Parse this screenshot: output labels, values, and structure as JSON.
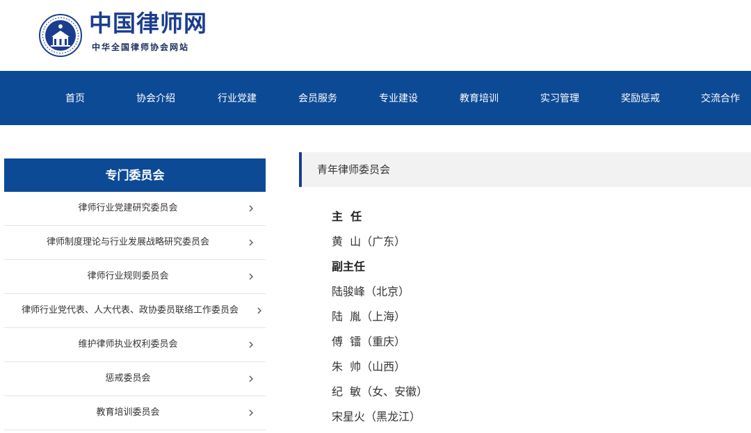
{
  "site": {
    "title": "中国律师网",
    "subtitle": "中华全国律师协会网站"
  },
  "nav": {
    "items": [
      {
        "label": "首页"
      },
      {
        "label": "协会介绍"
      },
      {
        "label": "行业党建"
      },
      {
        "label": "会员服务"
      },
      {
        "label": "专业建设"
      },
      {
        "label": "教育培训"
      },
      {
        "label": "实习管理"
      },
      {
        "label": "奖励惩戒"
      },
      {
        "label": "交流合作"
      }
    ]
  },
  "sidebar": {
    "title": "专门委员会",
    "items": [
      {
        "label": "律师行业党建研究委员会"
      },
      {
        "label": "律师制度理论与行业发展战略研究委员会"
      },
      {
        "label": "律师行业规则委员会"
      },
      {
        "label": "律师行业党代表、人大代表、政协委员联络工作委员会"
      },
      {
        "label": "维护律师执业权利委员会"
      },
      {
        "label": "惩戒委员会"
      },
      {
        "label": "教育培训委员会"
      }
    ]
  },
  "content": {
    "title": "青年律师委员会",
    "lines": [
      {
        "text": "主  任",
        "heading": true
      },
      {
        "text": "黄  山（广东）",
        "heading": false
      },
      {
        "text": "副主任",
        "heading": true
      },
      {
        "text": "陆骏峰（北京）",
        "heading": false
      },
      {
        "text": "陆  胤（上海）",
        "heading": false
      },
      {
        "text": "傅  镭（重庆）",
        "heading": false
      },
      {
        "text": "朱  帅（山西）",
        "heading": false
      },
      {
        "text": "纪  敏（女、安徽）",
        "heading": false
      },
      {
        "text": "宋星火（黑龙江）",
        "heading": false
      }
    ]
  },
  "colors": {
    "brand_blue": "#0d4a96",
    "accent_border": "#1a3d8f"
  }
}
